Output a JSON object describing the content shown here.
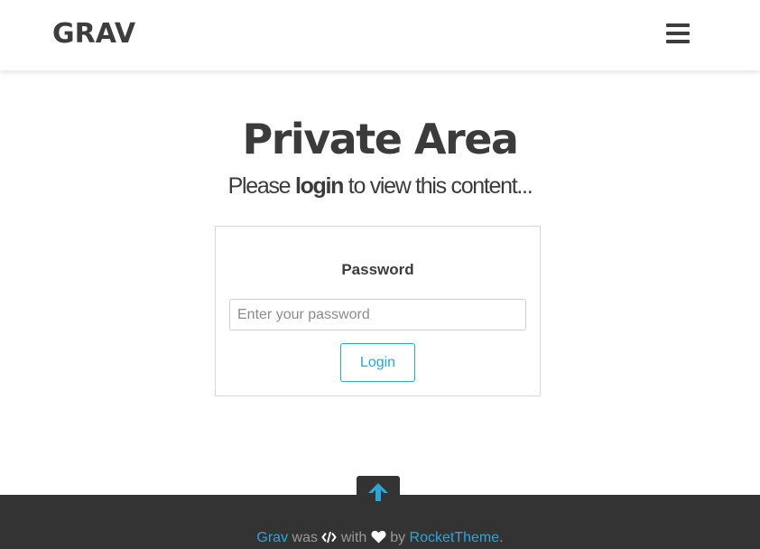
{
  "header": {
    "logo": "GRAV",
    "menu_icon": "hamburger-menu-icon"
  },
  "main": {
    "title": "Private Area",
    "subtitle": {
      "before": "Please ",
      "strong": "login",
      "after": " to view this content..."
    },
    "form": {
      "password_label": "Password",
      "password_placeholder": "Enter your password",
      "password_value": "",
      "login_label": "Login"
    }
  },
  "footer": {
    "to_top_icon": "arrow-up-icon",
    "credit": {
      "grav": "Grav",
      "was": " was ",
      "code_icon": "code-icon",
      "with": " with ",
      "heart_icon": "heart-icon",
      "by": " by ",
      "rockettheme": "RocketTheme",
      "end": "."
    }
  },
  "colors": {
    "accent": "#2fa4d6",
    "text": "#3b3b3b",
    "footer_bg": "#333333",
    "footer_text": "#9a9a9a"
  }
}
